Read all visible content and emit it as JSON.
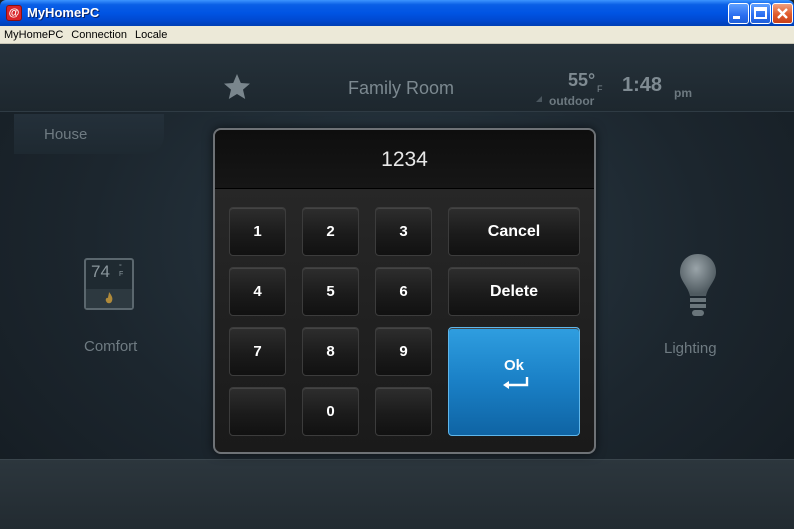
{
  "window": {
    "title": "MyHomePC",
    "app_icon": "app-logo-icon"
  },
  "menu": {
    "items": [
      "MyHomePC",
      "Connection",
      "Locale"
    ]
  },
  "header": {
    "room": "Family Room",
    "outdoor_temp": "55",
    "outdoor_degree": "°",
    "outdoor_unit": "F",
    "outdoor_label": "outdoor",
    "time": "1:48",
    "ampm": "pm"
  },
  "nav": {
    "house_tab": "House"
  },
  "tiles": {
    "comfort": {
      "temp": "74",
      "degree": "°",
      "unit": "F",
      "label": "Comfort"
    },
    "lighting": {
      "label": "Lighting"
    }
  },
  "keypad": {
    "display": "1234",
    "keys": [
      "1",
      "2",
      "3",
      "4",
      "5",
      "6",
      "7",
      "8",
      "9",
      "",
      "0",
      ""
    ],
    "cancel": "Cancel",
    "delete": "Delete",
    "ok": "Ok"
  },
  "colors": {
    "accent": "#1a80c6",
    "titlebar": "#0054e3"
  }
}
